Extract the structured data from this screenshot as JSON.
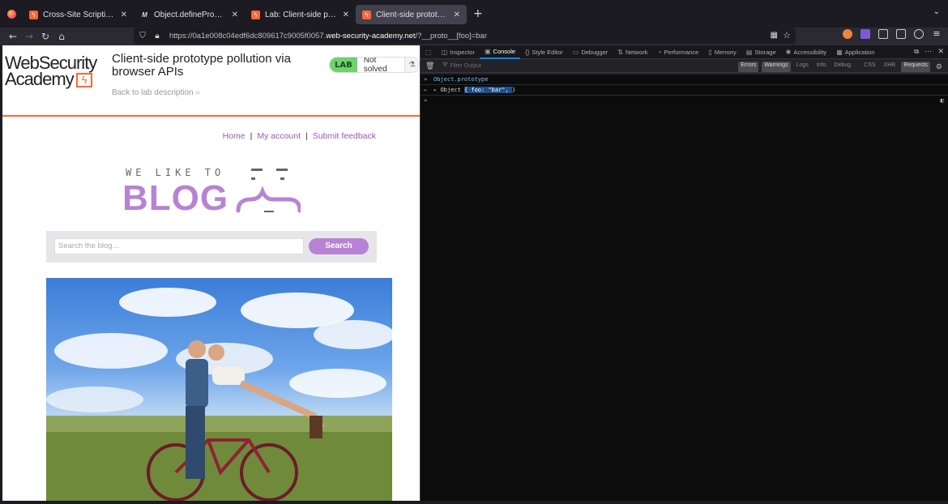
{
  "browser": {
    "tabs": [
      {
        "title": "Cross-Site Scripting (XSS)",
        "icon": "portswigger-icon",
        "active": false
      },
      {
        "title": "Object.defineProperty() -",
        "icon": "mdn-icon",
        "active": false
      },
      {
        "title": "Lab: Client-side prototype",
        "icon": "portswigger-icon",
        "active": false
      },
      {
        "title": "Client-side prototype poll",
        "icon": "portswigger-icon",
        "active": true
      }
    ],
    "close_glyph": "✕",
    "new_tab_glyph": "+",
    "url_prefix": "https://0a1e008c04edf6dc809617c9005f0057.",
    "url_domain": "web-security-academy.net",
    "url_suffix": "/?__proto__[foo]=bar"
  },
  "page": {
    "logo_line1": "WebSecurity",
    "logo_line2": "Academy",
    "lab_title": "Client-side prototype pollution via browser APIs",
    "back_link": "Back to lab description",
    "lab_badge": "LAB",
    "lab_status": "Not solved",
    "nav": {
      "home": "Home",
      "account": "My account",
      "feedback": "Submit feedback",
      "separator": "|"
    },
    "blog_tagline": "WE LIKE TO",
    "blog_word": "BLOG",
    "search_placeholder": "Search the blog...",
    "search_button": "Search",
    "accent": "#ff6633",
    "brand_purple": "#b883d4"
  },
  "devtools": {
    "tabs": [
      {
        "label": "Inspector",
        "icon": "inspector-icon"
      },
      {
        "label": "Console",
        "icon": "console-icon",
        "active": true
      },
      {
        "label": "Style Editor",
        "icon": "style-editor-icon"
      },
      {
        "label": "Debugger",
        "icon": "debugger-icon"
      },
      {
        "label": "Network",
        "icon": "network-icon"
      },
      {
        "label": "Performance",
        "icon": "performance-icon"
      },
      {
        "label": "Memory",
        "icon": "memory-icon"
      },
      {
        "label": "Storage",
        "icon": "storage-icon"
      },
      {
        "label": "Accessibility",
        "icon": "accessibility-icon"
      },
      {
        "label": "Application",
        "icon": "application-icon"
      }
    ],
    "filter_placeholder": "Filter Output",
    "filters": [
      "Errors",
      "Warnings",
      "Logs",
      "Info",
      "Debug",
      "CSS",
      "XHR",
      "Requests"
    ],
    "console": {
      "input_command": "Object.prototype",
      "result_prefix": "Object",
      "result_highlight": "{ foo: \"bar\", ",
      "result_suffix": "}"
    }
  }
}
